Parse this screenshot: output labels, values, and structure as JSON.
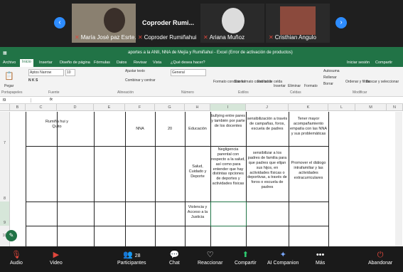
{
  "participants": [
    {
      "name": "María José paz Esrte...",
      "muted": true
    },
    {
      "name": "Coproder Rumiñahui",
      "muted": true
    },
    {
      "name": "Ariana Muñoz",
      "muted": true
    },
    {
      "name": "Cristhian Angulo",
      "muted": true
    }
  ],
  "header_name": "Coproder Rumi...",
  "excel": {
    "title": "aportes a la ANII, NNA de Mejía y Rumiñahui - Excel (Error de activación de productos)",
    "search": "¿Qué desea hacer?",
    "user": "Iniciar sesión",
    "share": "Compartir",
    "tabs": [
      "Archivo",
      "Inicio",
      "Insertar",
      "Diseño de página",
      "Fórmulas",
      "Datos",
      "Revisar",
      "Vista"
    ],
    "ribbon": {
      "paste": "Pegar",
      "font": "Aptos Narrow",
      "font_size": "10",
      "wrap": "Ajustar texto",
      "merge": "Combinar y centrar",
      "number_format": "General",
      "cond_format": "Formato condicional",
      "table_format": "Dar formato como tabla",
      "cell_styles": "Estilos de celda",
      "insert": "Insertar",
      "delete": "Eliminar",
      "format": "Formato",
      "autosum": "Autosuma",
      "fill": "Rellenar",
      "clear": "Borrar",
      "sort": "Ordenar y filtrar",
      "find": "Buscar y seleccionar",
      "groups": [
        "Portapapeles",
        "Fuente",
        "Alineación",
        "Número",
        "Estilos",
        "Celdas",
        "Modificar"
      ]
    },
    "name_box": "I9",
    "columns": [
      "B",
      "C",
      "D",
      "E",
      "F",
      "G",
      "H",
      "I",
      "J",
      "K",
      "L",
      "M",
      "N"
    ],
    "rows": [
      "7",
      "8",
      "9",
      "10"
    ],
    "cells": {
      "c7": "Rumiña hui y Quito",
      "f7": "NNA",
      "g7": "20",
      "h7": "Educación",
      "i7": "bullying entre pares y también por parte de los docentes",
      "j7": "sensibilización a través de campañas, foros, escuela de padres",
      "k7": "Tener mayor acompañamiento empatía con las NNA y sus problemáticas",
      "h8": "Salud, Cuidado y Deporte",
      "i8": "Negligencia parental con respecto a la salud, así como para entender que hay distintas opciones de deportes y actividades físicas",
      "j8": "sensibilizar a los padres de familia para que padres que elijan sus hijos, en actividades físicas o deportivas, a través de foros o escuela de padres",
      "k8": "Promover el diálogo intrafamiliar y las actividades extracurriculares",
      "h9": "Violencia y Acceso a la Justicia"
    }
  },
  "toolbar": {
    "audio": "Audio",
    "video": "Video",
    "participants": "Participantes",
    "participants_count": "28",
    "chat": "Chat",
    "react": "Reaccionar",
    "share": "Compartir",
    "companion": "AI Companion",
    "more": "Más",
    "leave": "Abandonar"
  }
}
